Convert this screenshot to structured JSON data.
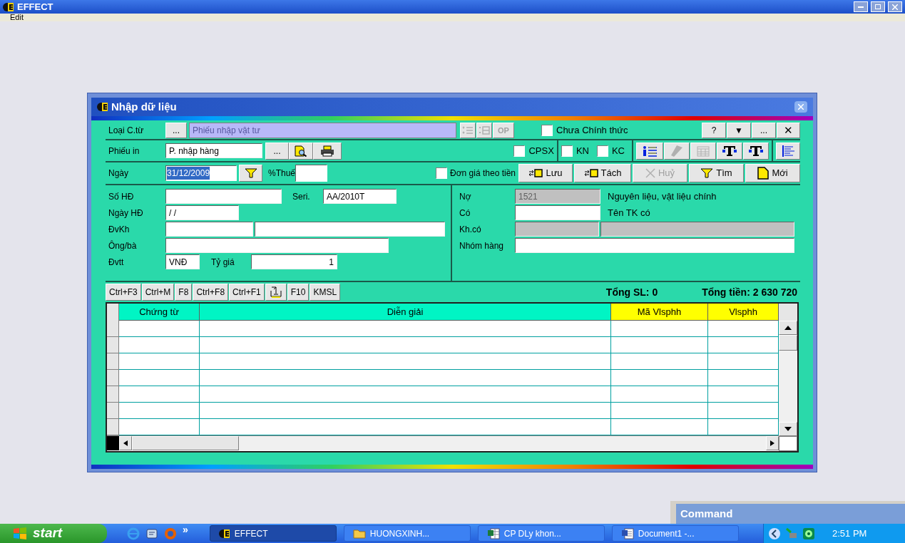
{
  "window": {
    "title": "EFFECT"
  },
  "menu": [
    {
      "label": "Edit"
    }
  ],
  "dialog": {
    "title": "Nhập dữ liệu",
    "doc_type": {
      "label": "Loại C.từ",
      "browse": "...",
      "value": "Phiếu nhập vật tư",
      "disabled": true
    },
    "doc_tools": [
      {
        "kind": "list",
        "disabled": true
      },
      {
        "kind": "grid",
        "disabled": true
      },
      {
        "kind": "text",
        "label": "OP",
        "disabled": true
      }
    ],
    "official": {
      "label": "Chưa Chính thức",
      "checked": false
    },
    "window_buttons": [
      "?",
      "▼",
      "...",
      "✕"
    ],
    "print_form": {
      "label": "Phiếu in",
      "value": "P. nhập hàng",
      "browse": "..."
    },
    "flags": [
      {
        "label": "CPSX",
        "checked": false
      },
      {
        "label": "KN",
        "checked": false
      },
      {
        "label": "KC",
        "checked": false
      }
    ],
    "format_tools": [
      {
        "kind": "person-list",
        "disabled": false
      },
      {
        "kind": "eraser",
        "disabled": true
      },
      {
        "kind": "table",
        "disabled": true
      },
      {
        "kind": "text-style",
        "disabled": false
      },
      {
        "kind": "text-style",
        "disabled": false
      }
    ],
    "date": {
      "label": "Ngày",
      "value": "31/12/2009",
      "selected": true
    },
    "tax": {
      "label": "%Thuế"
    },
    "price_by_amount": {
      "label": "Đơn giá theo tiền",
      "checked": false
    },
    "actions": [
      {
        "kind": "save",
        "label": "Lưu",
        "disabled": false
      },
      {
        "kind": "split",
        "label": "Tách",
        "disabled": false
      },
      {
        "kind": "cancel",
        "label": "Huỷ",
        "disabled": true
      },
      {
        "kind": "find",
        "label": "Tìm",
        "disabled": false
      },
      {
        "kind": "new",
        "label": "Mới",
        "disabled": false
      }
    ],
    "left_fields": [
      {
        "label": "Số HĐ",
        "fields": [
          {
            "disabled": false
          }
        ],
        "extra": {
          "label": "Seri.",
          "fields": [
            {
              "value": "AA/2010T",
              "disabled": false
            }
          ]
        }
      },
      {
        "label": "Ngày HĐ",
        "fields": [
          {
            "value": "/ /",
            "disabled": false
          }
        ]
      },
      {
        "label": "ĐvKh",
        "fields": [
          {
            "disabled": false
          },
          {
            "disabled": false
          }
        ]
      },
      {
        "label": "Ông/bà",
        "fields": [
          {
            "disabled": false
          }
        ]
      },
      {
        "label": "Đvtt",
        "fields": [
          {
            "value": "VNĐ",
            "disabled": false
          }
        ],
        "extra": {
          "label": "Tỷ giá",
          "fields": [
            {
              "value": "1",
              "disabled": false
            }
          ]
        }
      }
    ],
    "right_fields": [
      {
        "label": "Nợ",
        "fields": [
          {
            "value": "1521",
            "disabled": true
          }
        ],
        "note": "Nguyên liệu, vật liệu chính"
      },
      {
        "label": "Có",
        "fields": [
          {
            "disabled": false
          }
        ],
        "note": "Tên TK có"
      },
      {
        "label": "Kh.có",
        "fields": [
          {
            "disabled": true
          },
          {
            "disabled": true
          }
        ]
      },
      {
        "label": "Nhóm hàng",
        "fields": [
          {
            "disabled": false
          }
        ]
      }
    ],
    "shortcuts": [
      {
        "kind": "text",
        "label": "Ctrl+F3"
      },
      {
        "kind": "text",
        "label": "Ctrl+M"
      },
      {
        "kind": "text",
        "label": "F8"
      },
      {
        "kind": "text",
        "label": "Ctrl+F8"
      },
      {
        "kind": "text",
        "label": "Ctrl+F1"
      },
      {
        "kind": "icon"
      },
      {
        "kind": "text",
        "label": "F10"
      },
      {
        "kind": "text",
        "label": "KMSL"
      }
    ],
    "totals": {
      "quantity": "Tổng SL: 0",
      "amount": "Tổng tiền: 2 630 720"
    },
    "columns": [
      {
        "label": "Chứng từ",
        "color": "#00f5c4"
      },
      {
        "label": "Diễn giải",
        "color": "#00f5c4"
      },
      {
        "label": "Mã Vlsphh",
        "color": "#ffff00"
      },
      {
        "label": "Vlsphh",
        "color": "#ffff00"
      }
    ]
  },
  "command_window": {
    "title": "Command"
  },
  "taskbar": {
    "start": "start",
    "overflow": "»",
    "tasks": [
      {
        "kind": "app",
        "label": "EFFECT",
        "selected": true
      },
      {
        "kind": "folder",
        "label": "HUONGXINH...",
        "selected": false
      },
      {
        "kind": "sheet",
        "label": "CP DLy khon...",
        "selected": false
      },
      {
        "kind": "document",
        "label": "Document1 -...",
        "selected": false
      }
    ],
    "clock": "2:51 PM"
  }
}
